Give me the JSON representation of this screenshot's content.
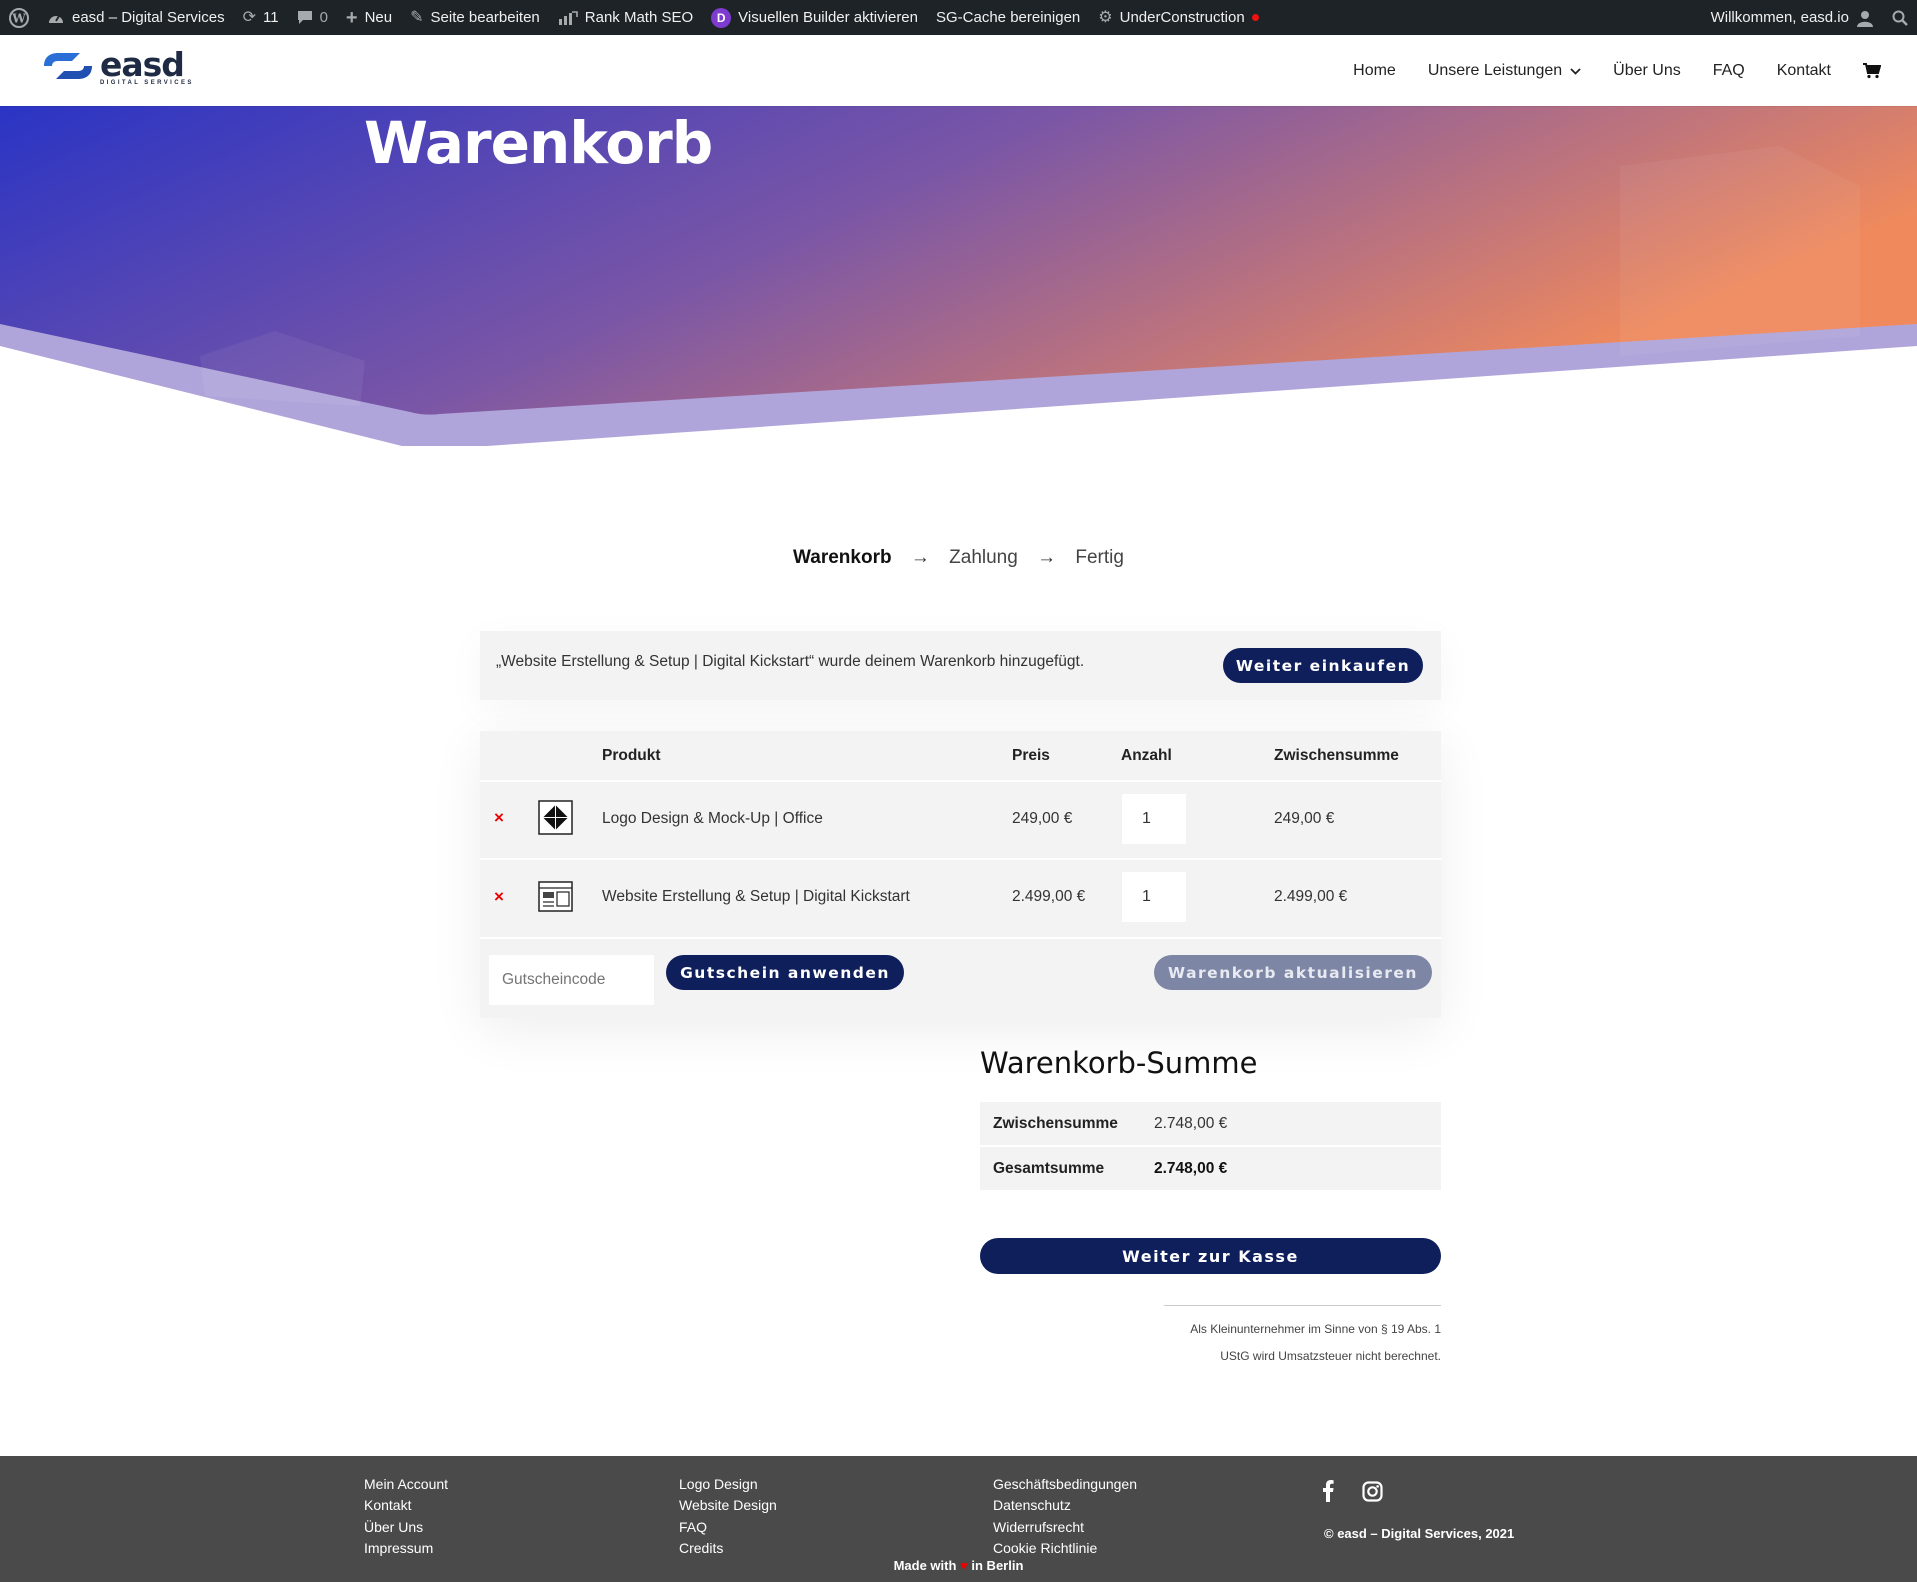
{
  "adminbar": {
    "site_name": "easd – Digital Services",
    "updates_count": "11",
    "comments_count": "0",
    "new_label": "Neu",
    "edit_page_label": "Seite bearbeiten",
    "rank_math_label": "Rank Math SEO",
    "divi_badge": "D",
    "visual_builder_label": "Visuellen Builder aktivieren",
    "sg_cache_label": "SG-Cache bereinigen",
    "under_construction_label": "UnderConstruction",
    "welcome_label": "Willkommen, easd.io"
  },
  "header": {
    "logo_text": "easd",
    "logo_sub": "DIGITAL SERVICES",
    "nav": {
      "home": "Home",
      "services": "Unsere Leistungen",
      "about": "Über Uns",
      "faq": "FAQ",
      "contact": "Kontakt"
    }
  },
  "hero": {
    "title": "Warenkorb",
    "gradient_start": "#2a34c4",
    "gradient_end": "#f08a5d"
  },
  "steps": {
    "step1": "Warenkorb",
    "step2": "Zahlung",
    "step3": "Fertig",
    "arrow": "→"
  },
  "notice": {
    "message": "„Website Erstellung & Setup | Digital Kickstart“ wurde deinem Warenkorb hinzugefügt.",
    "continue_label": "Weiter einkaufen"
  },
  "cart": {
    "headers": {
      "product": "Produkt",
      "price": "Preis",
      "quantity": "Anzahl",
      "subtotal": "Zwischensumme"
    },
    "remove_symbol": "×",
    "items": [
      {
        "name": "Logo Design & Mock-Up | Office",
        "price": "249,00 €",
        "quantity": "1",
        "subtotal": "249,00 €",
        "icon": "logo-design-icon"
      },
      {
        "name": "Website Erstellung & Setup | Digital Kickstart",
        "price": "2.499,00 €",
        "quantity": "1",
        "subtotal": "2.499,00 €",
        "icon": "website-layout-icon"
      }
    ],
    "coupon_placeholder": "Gutscheincode",
    "apply_coupon_label": "Gutschein anwenden",
    "update_cart_label": "Warenkorb aktualisieren"
  },
  "totals": {
    "title": "Warenkorb-Summe",
    "subtotal_label": "Zwischensumme",
    "subtotal_value": "2.748,00 €",
    "total_label": "Gesamtsumme",
    "total_value": "2.748,00 €",
    "checkout_label": "Weiter zur Kasse",
    "tax_note_line1": "Als Kleinunternehmer im Sinne von § 19 Abs. 1",
    "tax_note_line2": "UStG wird Umsatzsteuer nicht berechnet."
  },
  "footer": {
    "col1": [
      "Mein Account",
      "Kontakt",
      "Über Uns",
      "Impressum"
    ],
    "col2": [
      "Logo Design",
      "Website Design",
      "FAQ",
      "Credits"
    ],
    "col3": [
      "Geschäftsbedingungen",
      "Datenschutz",
      "Widerrufsrecht",
      "Cookie Richtlinie"
    ],
    "copyright": "© easd – Digital Services, 2021",
    "made_with_prefix": "Made with",
    "heart": "♥",
    "made_with_suffix": "in Berlin"
  },
  "colors": {
    "primary_dark": "#0f1f5c",
    "muted_button": "#7e86a6",
    "remove_red": "#e00000"
  }
}
